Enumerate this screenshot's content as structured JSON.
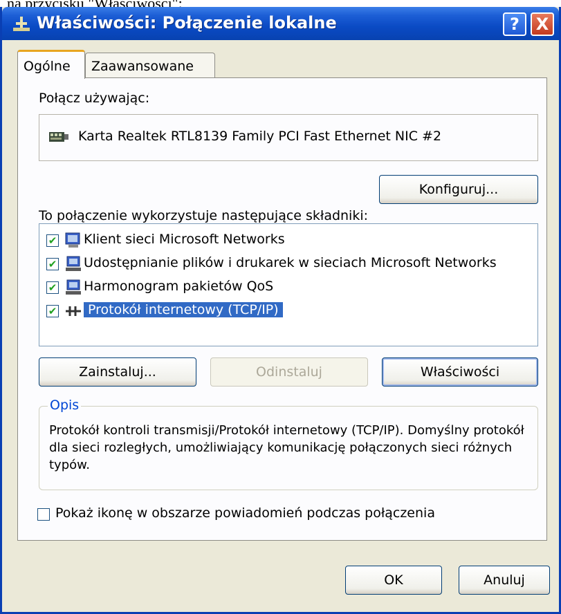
{
  "page_text_above": "na przycisku \"Właściwości\":",
  "window": {
    "title": "Właściwości: Połączenie lokalne",
    "help_button": "?",
    "close_button": "X"
  },
  "tabs": [
    {
      "label": "Ogólne",
      "active": true
    },
    {
      "label": "Zaawansowane",
      "active": false
    }
  ],
  "connect_using": {
    "label": "Połącz używając:",
    "device": "Karta Realtek RTL8139 Family PCI Fast Ethernet NIC #2",
    "configure_button": "Konfiguruj..."
  },
  "components": {
    "label": "To połączenie wykorzystuje następujące składniki:",
    "items": [
      {
        "label": "Klient sieci Microsoft Networks",
        "checked": true,
        "icon": "network-client-icon",
        "selected": false
      },
      {
        "label": "Udostępnianie plików i drukarek w sieciach Microsoft Networks",
        "checked": true,
        "icon": "network-service-icon",
        "selected": false
      },
      {
        "label": "Harmonogram pakietów QoS",
        "checked": true,
        "icon": "network-service-icon",
        "selected": false
      },
      {
        "label": "Protokół internetowy (TCP/IP)",
        "checked": true,
        "icon": "protocol-icon",
        "selected": true
      }
    ]
  },
  "buttons": {
    "install": "Zainstaluj...",
    "uninstall": "Odinstaluj",
    "properties": "Właściwości"
  },
  "description": {
    "label": "Opis",
    "text": "Protokół kontroli transmisji/Protokół internetowy (TCP/IP). Domyślny protokół dla sieci rozległych, umożliwiający komunikację połączonych sieci różnych typów."
  },
  "show_icon_checkbox": {
    "label": "Pokaż ikonę w obszarze powiadomień podczas połączenia",
    "checked": false
  },
  "dialog_buttons": {
    "ok": "OK",
    "cancel": "Anuluj"
  },
  "colors": {
    "titlebar": "#0a4ac4",
    "dialog_bg": "#ebe9d8",
    "selection": "#316ac5",
    "groupbox_label": "#0046d5"
  }
}
